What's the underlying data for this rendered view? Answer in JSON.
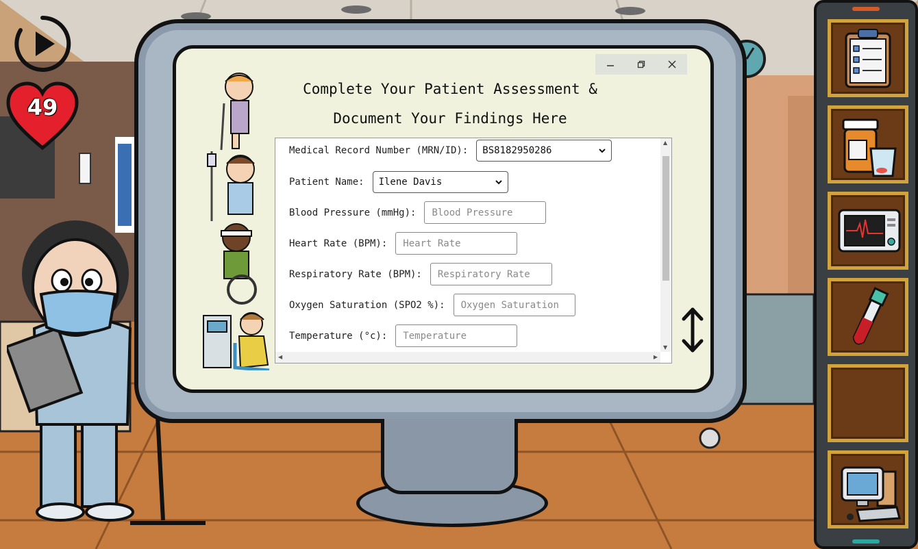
{
  "hud": {
    "lives": "49",
    "play_icon": "play-icon",
    "heart_icon": "heart-icon"
  },
  "window": {
    "title_line1": "Complete Your Patient Assessment &",
    "title_line2": "Document Your Findings Here",
    "controls": [
      "minimize-icon",
      "restore-icon",
      "close-icon"
    ]
  },
  "form": {
    "mrn": {
      "label": "Medical Record Number (MRN/ID):",
      "value": "BS8182950286"
    },
    "patient_name": {
      "label": "Patient Name:",
      "value": "Ilene Davis"
    },
    "blood_pressure": {
      "label": "Blood Pressure (mmHg):",
      "placeholder": "Blood Pressure"
    },
    "heart_rate": {
      "label": "Heart Rate (BPM):",
      "placeholder": "Heart Rate"
    },
    "respiratory_rate": {
      "label": "Respiratory Rate (BPM):",
      "placeholder": "Respiratory Rate"
    },
    "oxygen_saturation": {
      "label": "Oxygen Saturation (SPO2 %):",
      "placeholder": "Oxygen Saturation"
    },
    "temperature": {
      "label": "Temperature (°c):",
      "placeholder": "Temperature"
    }
  },
  "toolbar": {
    "items": [
      "clipboard-icon",
      "medication-icon",
      "heart-monitor-icon",
      "blood-test-tube-icon",
      "empty-slot",
      "computer-icon"
    ]
  },
  "colors": {
    "screen_bg": "#f0f2de",
    "bezel": "#a9b7c5",
    "slot_border": "#d2a33a",
    "slot_bg": "#6a3b16",
    "heart": "#e3202b"
  }
}
